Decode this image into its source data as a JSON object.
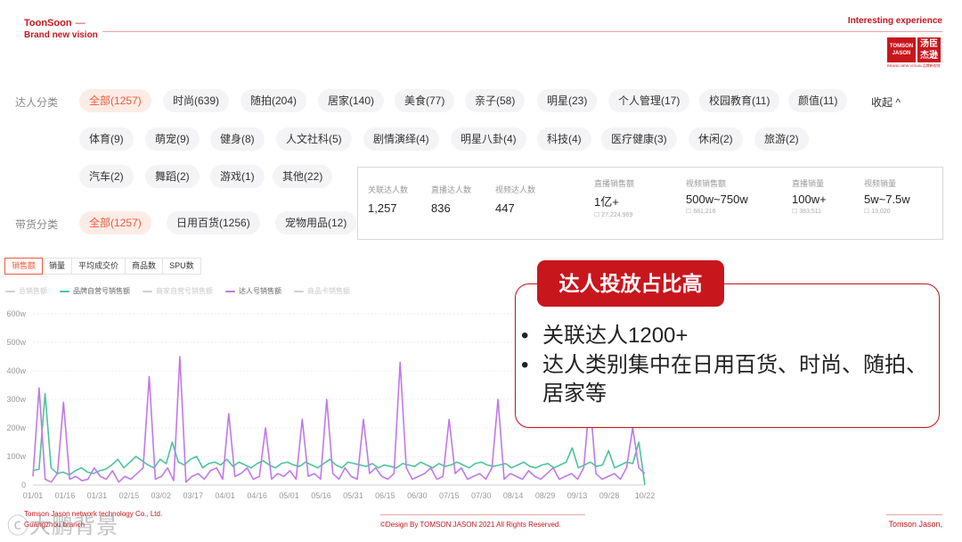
{
  "header": {
    "brand_name": "ToonSoon",
    "brand_dash": "—",
    "brand_tagline": "Brand new vision",
    "right_text": "Interesting experience"
  },
  "logo": {
    "left_line1": "TOMSON",
    "left_line2": "JASON",
    "right_line1": "汤臣",
    "right_line2": "杰逊",
    "subtitle": "BRAND NEW VISUAL品牌新视觉"
  },
  "filters": {
    "talent_label": "达人分类",
    "talent_chips": [
      "全部(1257)",
      "时尚(639)",
      "随拍(204)",
      "居家(140)",
      "美食(77)",
      "亲子(58)",
      "明星(23)",
      "个人管理(17)",
      "校园教育(11)",
      "颜值(11)",
      "体育(9)",
      "萌宠(9)",
      "健身(8)",
      "人文社科(5)",
      "剧情演绎(4)",
      "明星八卦(4)",
      "科技(4)",
      "医疗健康(3)",
      "休闲(2)",
      "旅游(2)",
      "汽车(2)",
      "舞蹈(2)",
      "游戏(1)",
      "其他(22)"
    ],
    "collapse": "收起 ^",
    "goods_label": "带货分类",
    "goods_chips": [
      "全部(1257)",
      "日用百货(1256)",
      "宠物用品(12)"
    ]
  },
  "stats": [
    {
      "label": "关联达人数",
      "value": "1,257",
      "sub": ""
    },
    {
      "label": "直播达人数",
      "value": "836",
      "sub": ""
    },
    {
      "label": "视频达人数",
      "value": "447",
      "sub": ""
    },
    {
      "label": "直播销售额",
      "value": "1亿+",
      "sub": "☐ 27,224,969"
    },
    {
      "label": "视频销售额",
      "value": "500w~750w",
      "sub": "☐ 681,216"
    },
    {
      "label": "直播销量",
      "value": "100w+",
      "sub": "☐ 383,511"
    },
    {
      "label": "视频销量",
      "value": "5w~7.5w",
      "sub": "☐ 13,020"
    }
  ],
  "chart_tabs": [
    "销售额",
    "销量",
    "平均成交价",
    "商品数",
    "SPU数"
  ],
  "legend": [
    {
      "name": "总销售额",
      "color": "#d0d0d0",
      "on": false
    },
    {
      "name": "品牌自营号销售额",
      "color": "#4cc49a",
      "on": true
    },
    {
      "name": "商家自营号销售额",
      "color": "#d0d0d0",
      "on": false
    },
    {
      "name": "达人号销售额",
      "color": "#c079e8",
      "on": true
    },
    {
      "name": "商品卡销售额",
      "color": "#d0d0d0",
      "on": false
    }
  ],
  "chart_data": {
    "type": "line",
    "xlabel": "",
    "ylabel": "",
    "y_ticks": [
      "0",
      "100w",
      "200w",
      "300w",
      "400w",
      "500w",
      "600w"
    ],
    "ylim": [
      0,
      600
    ],
    "x_ticks": [
      "01/01",
      "01/16",
      "01/31",
      "02/15",
      "03/02",
      "03/17",
      "04/01",
      "04/16",
      "05/01",
      "05/16",
      "05/31",
      "06/15",
      "06/30",
      "07/15",
      "07/30",
      "08/14",
      "08/29",
      "09/13",
      "09/28",
      "10/22"
    ],
    "grid": true,
    "series": [
      {
        "name": "品牌自营号销售额",
        "color": "#4cc49a",
        "values": [
          50,
          55,
          320,
          60,
          40,
          45,
          35,
          50,
          60,
          45,
          40,
          50,
          55,
          70,
          90,
          60,
          80,
          100,
          85,
          70,
          60,
          90,
          75,
          150,
          80,
          70,
          90,
          100,
          60,
          75,
          80,
          70,
          90,
          65,
          80,
          70,
          60,
          75,
          85,
          70,
          60,
          75,
          80,
          70,
          65,
          80,
          70,
          60,
          75,
          90,
          70,
          60,
          80,
          75,
          70,
          65,
          75,
          60,
          70,
          65,
          60,
          75,
          70,
          65,
          80,
          70,
          60,
          75,
          65,
          70,
          80,
          70,
          60,
          75,
          80,
          70,
          65,
          70,
          75,
          60,
          70,
          80,
          65,
          60,
          70,
          75,
          60,
          70,
          80,
          130,
          60,
          70,
          80,
          65,
          70,
          120,
          60,
          70,
          80,
          75,
          150,
          0
        ]
      },
      {
        "name": "达人号销售额",
        "color": "#c079e8",
        "values": [
          30,
          340,
          20,
          10,
          40,
          290,
          20,
          30,
          15,
          20,
          60,
          30,
          20,
          50,
          10,
          30,
          20,
          40,
          60,
          380,
          20,
          30,
          60,
          15,
          450,
          10,
          30,
          40,
          20,
          50,
          60,
          20,
          250,
          30,
          40,
          60,
          20,
          30,
          200,
          20,
          40,
          30,
          50,
          20,
          230,
          30,
          40,
          20,
          300,
          40,
          20,
          60,
          30,
          20,
          230,
          40,
          60,
          30,
          20,
          40,
          430,
          60,
          20,
          30,
          40,
          60,
          20,
          30,
          230,
          40,
          60,
          20,
          30,
          40,
          20,
          60,
          300,
          20,
          40,
          30,
          20,
          50,
          30,
          20,
          40,
          60,
          20,
          30,
          40,
          20,
          60,
          300,
          40,
          20,
          30,
          40,
          20,
          60,
          200,
          60,
          40
        ]
      }
    ]
  },
  "callout": {
    "title": "达人投放占比高",
    "bullets": [
      "关联达人1200+",
      "达人类别集中在日用百货、时尚、随拍、居家等"
    ]
  },
  "footer": {
    "company_line1": "Tomson Jason network technology Co., Ltd.",
    "company_line2": "Guangzhou branch",
    "center": "©Design By TOMSON JASON 2021 All Rights Reserved.",
    "right": "Tomson Jason,",
    "watermark": "ⓒ大鹏背景"
  }
}
